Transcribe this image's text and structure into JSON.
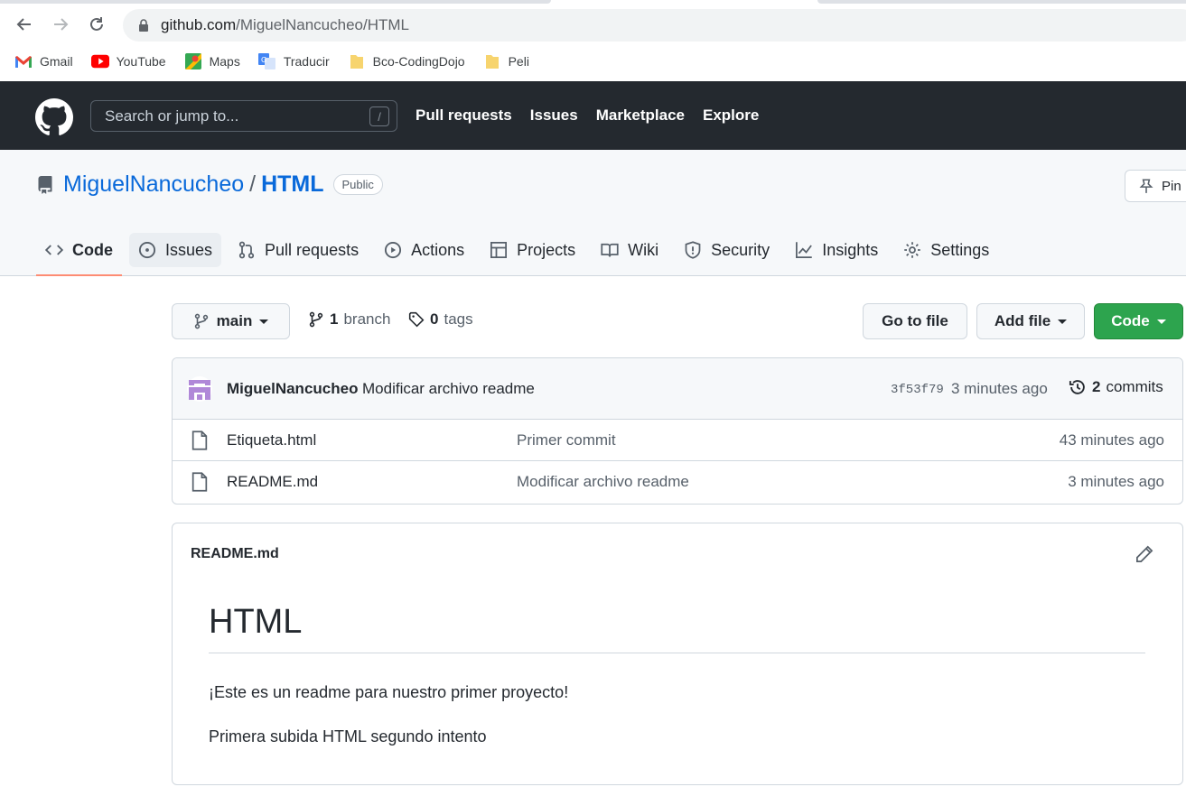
{
  "browser": {
    "url_host": "github.com",
    "url_path": "/MiguelNancucheo/HTML",
    "bookmarks": [
      "Gmail",
      "YouTube",
      "Maps",
      "Traducir",
      "Bco-CodingDojo",
      "Peli"
    ]
  },
  "github_header": {
    "search_placeholder": "Search or jump to...",
    "search_shortcut": "/",
    "nav": [
      "Pull requests",
      "Issues",
      "Marketplace",
      "Explore"
    ]
  },
  "repo": {
    "owner": "MiguelNancucheo",
    "separator": "/",
    "name": "HTML",
    "visibility": "Public",
    "pin_label": "Pin",
    "tabs": [
      "Code",
      "Issues",
      "Pull requests",
      "Actions",
      "Projects",
      "Wiki",
      "Security",
      "Insights",
      "Settings"
    ]
  },
  "toolbar": {
    "branch": "main",
    "branch_count": "1",
    "branch_label": "branch",
    "tag_count": "0",
    "tag_label": "tags",
    "go_to_file": "Go to file",
    "add_file": "Add file",
    "code": "Code"
  },
  "latest_commit": {
    "author": "MiguelNancucheo",
    "message": "Modificar archivo readme",
    "sha": "3f53f79",
    "time": "3 minutes ago",
    "commit_count": "2",
    "commit_label": "commits"
  },
  "files": [
    {
      "name": "Etiqueta.html",
      "message": "Primer commit",
      "age": "43 minutes ago"
    },
    {
      "name": "README.md",
      "message": "Modificar archivo readme",
      "age": "3 minutes ago"
    }
  ],
  "readme": {
    "filename": "README.md",
    "heading": "HTML",
    "paragraph1": "¡Este es un readme para nuestro primer proyecto!",
    "paragraph2": "Primera subida HTML segundo intento"
  },
  "colors": {
    "header_bg": "#24292f",
    "link_blue": "#0969da",
    "green_button": "#2da44e",
    "active_tab_underline": "#fd8c73"
  }
}
